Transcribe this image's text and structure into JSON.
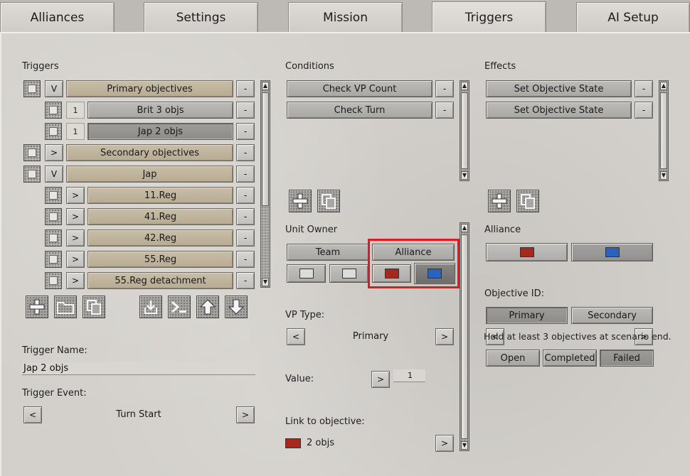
{
  "tabs": [
    "Alliances",
    "Settings",
    "Mission",
    "Triggers",
    "AI Setup"
  ],
  "active_tab": "Triggers",
  "triggers": {
    "heading": "Triggers",
    "rows": [
      {
        "toggle": "V",
        "label": "Primary objectives"
      },
      {
        "num": "1",
        "label": "Brit 3 objs"
      },
      {
        "num": "1",
        "label": "Jap 2 objs"
      },
      {
        "toggle": ">",
        "label": "Secondary objectives"
      },
      {
        "toggle": "V",
        "label": "Jap"
      },
      {
        "toggle": ">",
        "label": "11.Reg"
      },
      {
        "toggle": ">",
        "label": "41.Reg"
      },
      {
        "toggle": ">",
        "label": "42.Reg"
      },
      {
        "toggle": ">",
        "label": "55.Reg"
      },
      {
        "toggle": ">",
        "label": "55.Reg detachment"
      }
    ],
    "remove_label": "-",
    "tools": [
      "add-icon",
      "folder-icon",
      "copy-icon",
      "import-icon",
      "console-icon",
      "move-up-icon",
      "move-down-icon"
    ]
  },
  "trigger_name": {
    "label": "Trigger Name:",
    "value": "Jap 2 objs"
  },
  "trigger_event": {
    "label": "Trigger Event:",
    "value": "Turn Start",
    "prev": "<",
    "next": ">"
  },
  "conditions": {
    "heading": "Conditions",
    "items": [
      "Check VP Count",
      "Check Turn"
    ],
    "remove_label": "-"
  },
  "effects": {
    "heading": "Effects",
    "items": [
      "Set Objective State",
      "Set Objective State"
    ],
    "remove_label": "-"
  },
  "unit_owner": {
    "label": "Unit Owner",
    "team": "Team",
    "alliance": "Alliance"
  },
  "vp_type": {
    "label": "VP Type:",
    "value": "Primary",
    "prev": "<",
    "next": ">"
  },
  "value": {
    "label": "Value:",
    "value": "1",
    "btn": ">"
  },
  "link": {
    "label": "Link to objective:",
    "value": "2 objs",
    "btn": ">"
  },
  "alliance": {
    "label": "Alliance"
  },
  "objective_id": {
    "label": "Objective ID:",
    "primary": "Primary",
    "secondary": "Secondary"
  },
  "objective_text": "Hold at least 3 objectives at scenario end.",
  "objective_nav": {
    "prev": "<",
    "next": ">"
  },
  "objective_state": [
    "Open",
    "Completed",
    "Failed"
  ],
  "colors": {
    "red": "#a8281e",
    "blue": "#2a62c0",
    "white": "#dcdcdc",
    "highlight": "#e8151b"
  }
}
